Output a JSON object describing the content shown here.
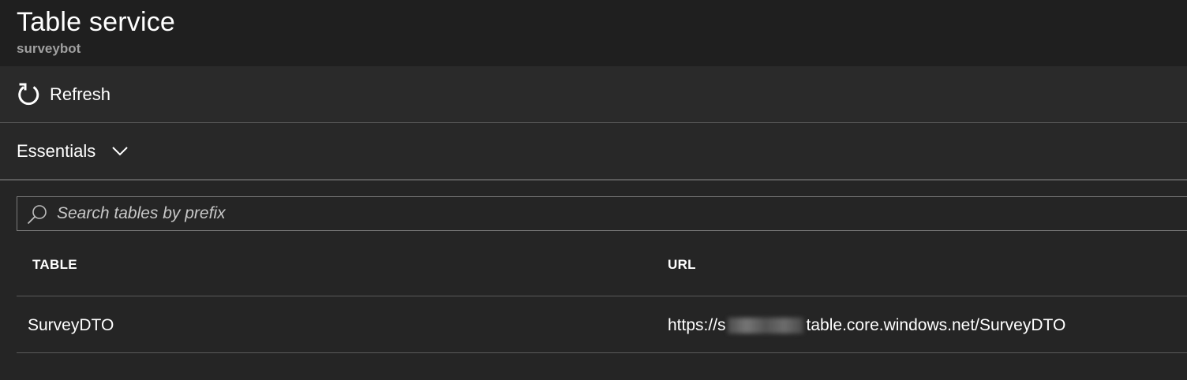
{
  "header": {
    "title": "Table service",
    "subtitle": "surveybot"
  },
  "toolbar": {
    "refresh_label": "Refresh",
    "refresh_icon": "refresh-icon"
  },
  "essentials": {
    "label": "Essentials",
    "icon": "chevron-down-icon"
  },
  "search": {
    "placeholder": "Search tables by prefix",
    "value": "",
    "icon": "search-icon"
  },
  "table": {
    "columns": [
      "TABLE",
      "URL"
    ],
    "rows": [
      {
        "name": "SurveyDTO",
        "url_prefix": "https://s",
        "url_suffix": "table.core.windows.net/SurveyDTO"
      }
    ]
  },
  "colors": {
    "background": "#252525",
    "header_background": "#1f1f1f",
    "subtitle": "#a0a0a0",
    "divider": "#5a5a5a"
  }
}
